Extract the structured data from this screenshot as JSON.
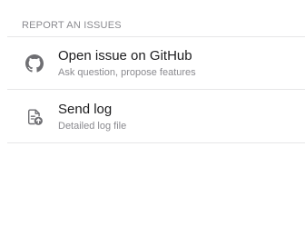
{
  "section": {
    "header": "REPORT AN ISSUES"
  },
  "items": [
    {
      "title": "Open issue on GitHub",
      "subtitle": "Ask question, propose features",
      "icon": "github-icon"
    },
    {
      "title": "Send log",
      "subtitle": "Detailed log file",
      "icon": "file-upload-icon"
    }
  ],
  "colors": {
    "title": "#1c1c1e",
    "secondary": "#8a8a8f",
    "icon": "#6f6f73",
    "divider": "#e6e6e8"
  }
}
